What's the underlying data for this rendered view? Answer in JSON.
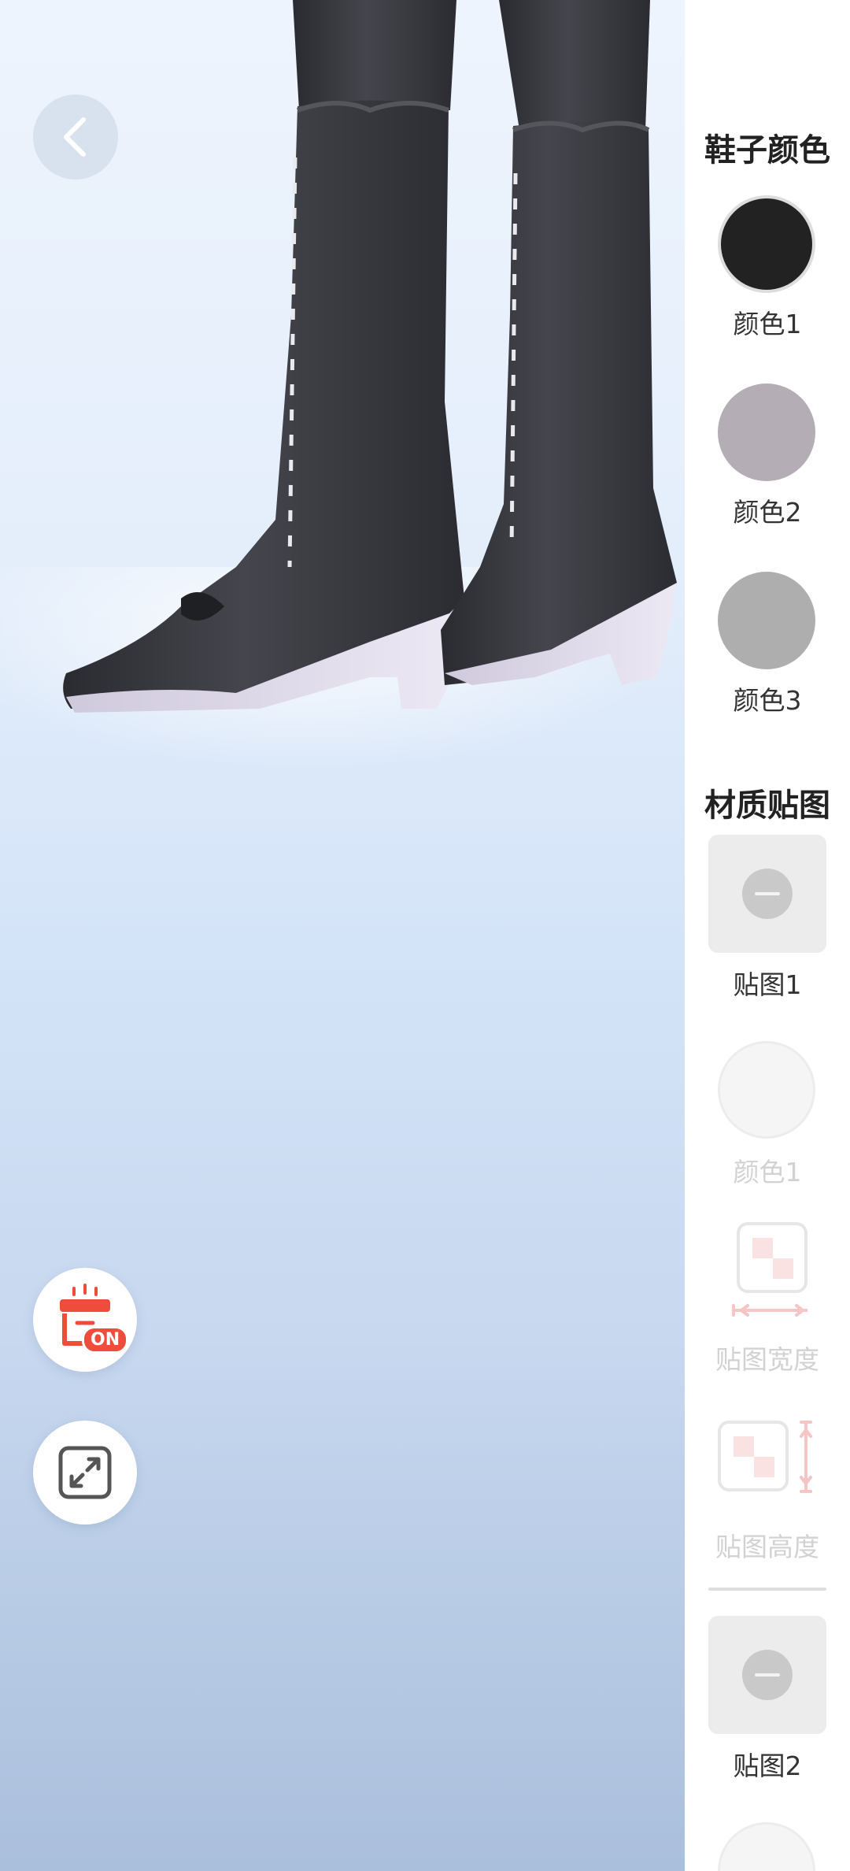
{
  "nav": {
    "back_icon": "chevron-left-icon"
  },
  "floating": {
    "storage_badge": "ON",
    "storage_icon": "gift-box-icon",
    "fullscreen_icon": "expand-arrows-icon"
  },
  "panel": {
    "shoe_color_title": "鞋子颜色",
    "shoe_colors": [
      {
        "label": "颜色1",
        "color": "#222222"
      },
      {
        "label": "颜色2",
        "color": "#b5adb5"
      },
      {
        "label": "颜色3",
        "color": "#aeaeae"
      }
    ],
    "material_title": "材质贴图",
    "texture1": {
      "label": "贴图1",
      "color_label": "颜色1",
      "width_label": "贴图宽度",
      "height_label": "贴图高度"
    },
    "texture2": {
      "label": "贴图2"
    }
  },
  "colors": {
    "accent_red": "#ee4d3c",
    "panel_bg": "#ffffff",
    "disabled_text": "#d2d2d2"
  }
}
